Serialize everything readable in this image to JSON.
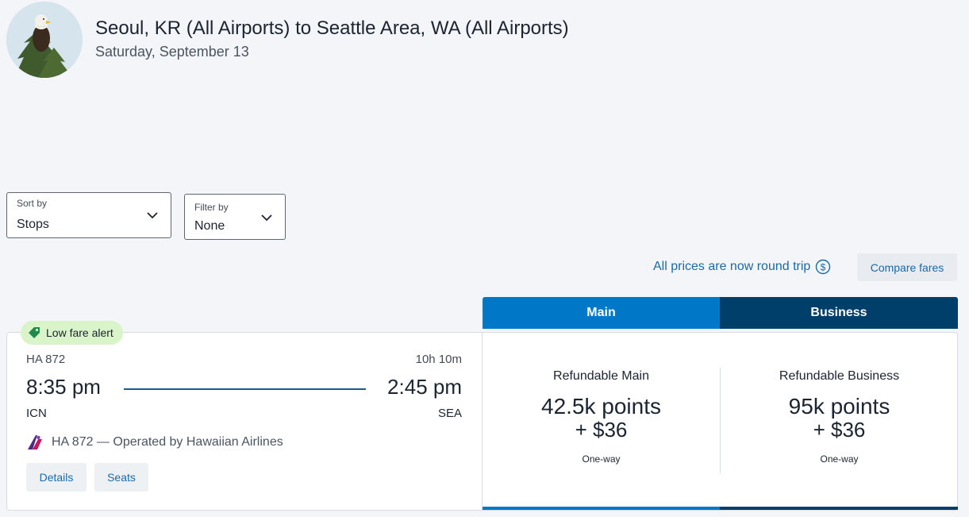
{
  "header": {
    "title": "Seoul, KR (All Airports) to Seattle Area, WA (All Airports)",
    "date": "Saturday, September 13"
  },
  "controls": {
    "sort": {
      "label": "Sort by",
      "value": "Stops"
    },
    "filter": {
      "label": "Filter by",
      "value": "None"
    },
    "round_trip_notice": "All prices are now round trip",
    "compare_fares": "Compare fares"
  },
  "cabins": {
    "main": "Main",
    "business": "Business"
  },
  "flight": {
    "badge": "Low fare alert",
    "number": "HA 872",
    "duration": "10h 10m",
    "departure_time": "8:35 pm",
    "arrival_time": "2:45 pm",
    "origin": "ICN",
    "destination": "SEA",
    "operated_by": "HA 872 — Operated by Hawaiian Airlines",
    "details_label": "Details",
    "seats_label": "Seats"
  },
  "fares": [
    {
      "name": "Refundable Main",
      "points": "42.5k points",
      "cash": "+ $36",
      "trip_type": "One-way"
    },
    {
      "name": "Refundable Business",
      "points": "95k points",
      "cash": "+ $36",
      "trip_type": "One-way"
    }
  ],
  "colors": {
    "main_tab": "#0078c8",
    "business_tab": "#003f6a",
    "link": "#1a6aa6",
    "alert_bg": "#d9f4c9",
    "page_bg": "#f4f5f8"
  },
  "icons": {
    "avatar": "eagle-avatar",
    "chevron": "chevron-down-icon",
    "dollar": "dollar-circle-icon",
    "tag": "price-tag-icon",
    "airline": "hawaiian-airlines-logo"
  }
}
